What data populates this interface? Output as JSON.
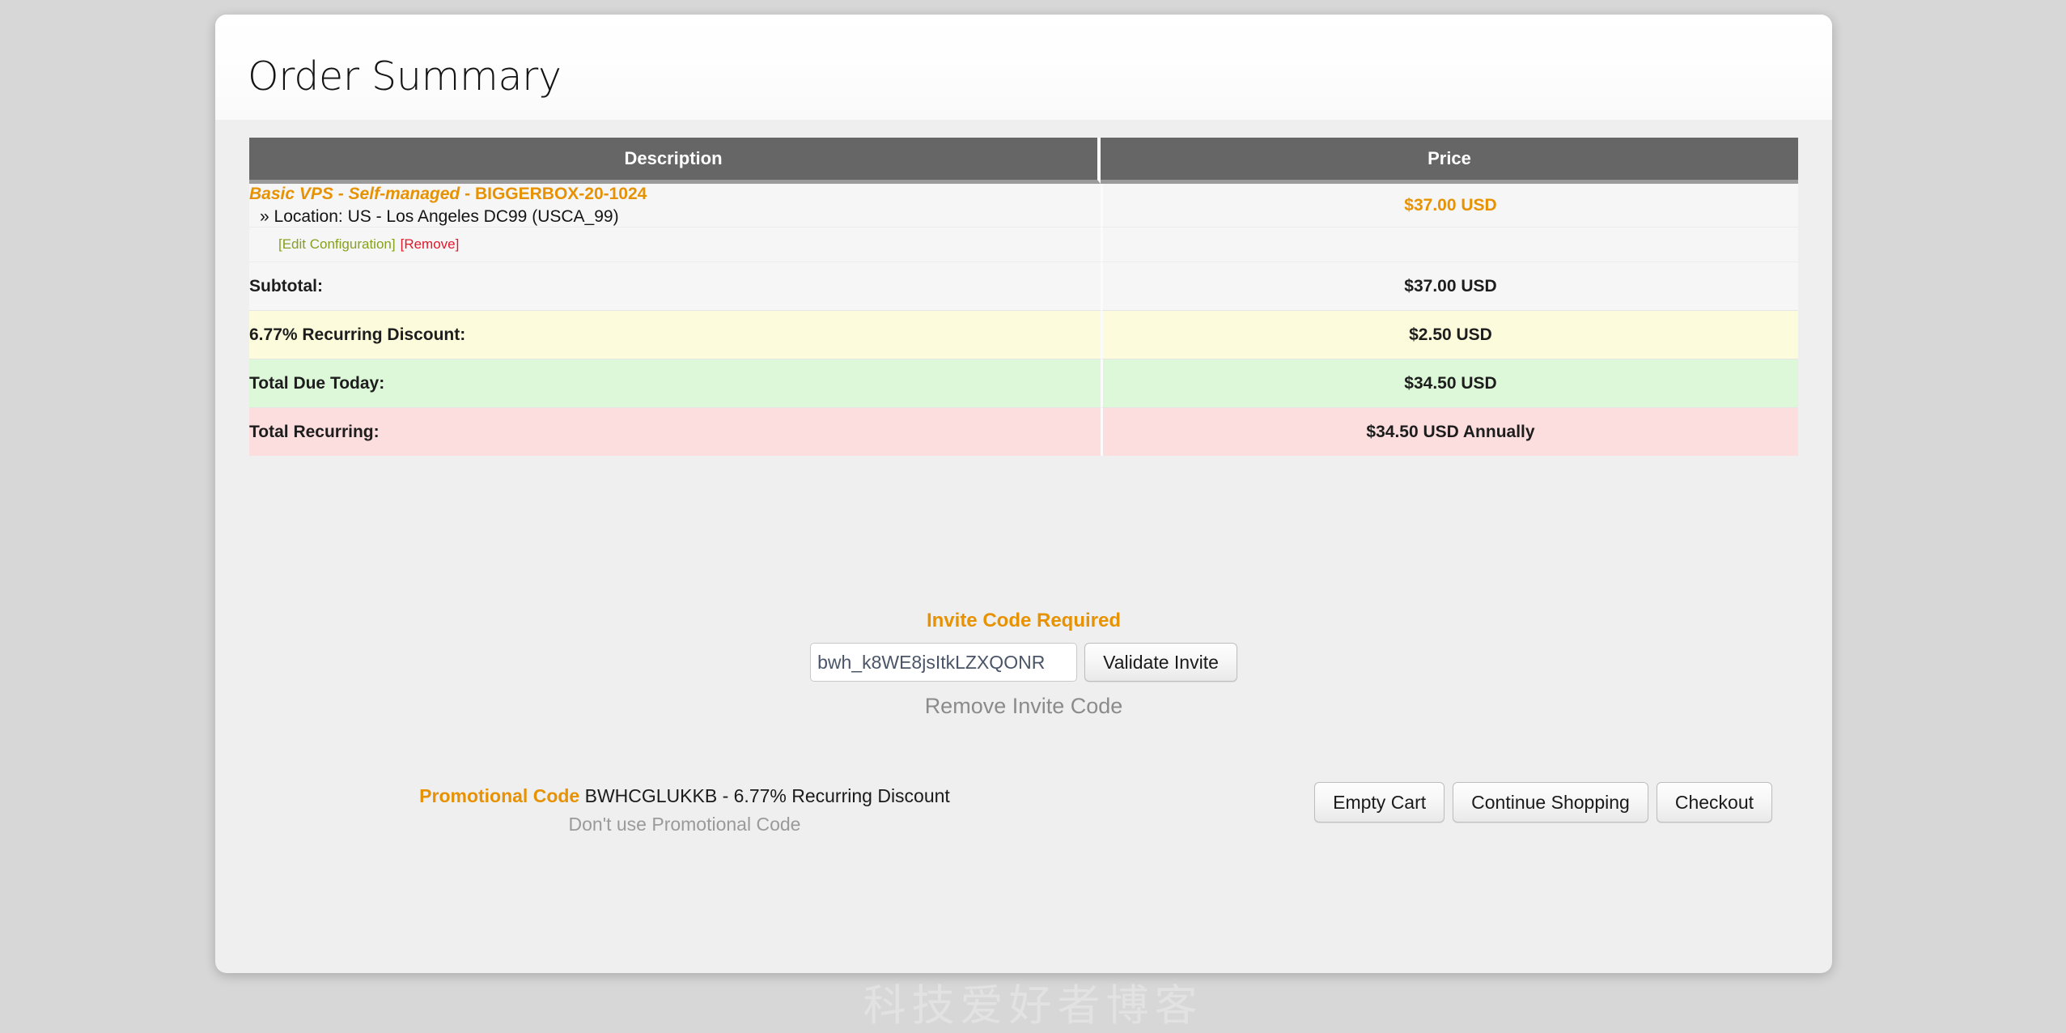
{
  "page": {
    "title": "Order Summary",
    "watermark": "科技爱好者博客",
    "accent_color": "#e79203",
    "header_bg": "#666666",
    "page_bg": "#d7d7d7",
    "card_bg": "#efefef"
  },
  "table": {
    "headers": {
      "description": "Description",
      "price": "Price"
    },
    "item": {
      "name_italic": "Basic VPS - Self-managed",
      "name_separator": " - ",
      "name_code": "BIGGERBOX-20-1024",
      "location": "» Location: US - Los Angeles DC99 (USCA_99)",
      "price": "$37.00 USD",
      "edit_link": "[Edit Configuration]",
      "remove_link": "[Remove]"
    },
    "summary_rows": [
      {
        "label": "Subtotal:",
        "value": "$37.00 USD",
        "style": "plain"
      },
      {
        "label": "6.77% Recurring Discount:",
        "value": "$2.50 USD",
        "style": "yellow"
      },
      {
        "label": "Total Due Today:",
        "value": "$34.50 USD",
        "style": "green"
      },
      {
        "label": "Total Recurring:",
        "value": "$34.50 USD Annually",
        "style": "pink"
      }
    ]
  },
  "invite": {
    "title": "Invite Code Required",
    "value": "bwh_k8WE8jsItkLZXQONR",
    "placeholder": "Invite Code",
    "validate_label": "Validate Invite",
    "remove_label": "Remove Invite Code"
  },
  "promo": {
    "label": "Promotional Code",
    "detail": "BWHCGLUKKB - 6.77% Recurring Discount",
    "dismiss_label": "Don't use Promotional Code"
  },
  "actions": {
    "empty_cart": "Empty Cart",
    "continue_shopping": "Continue Shopping",
    "checkout": "Checkout"
  }
}
